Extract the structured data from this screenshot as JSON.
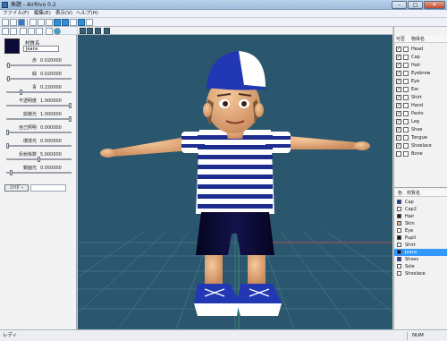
{
  "window": {
    "title": "無題 - AirRivo 0.2"
  },
  "menu": [
    "ファイル(F)",
    "編集(E)",
    "表示(V)",
    "ヘルプ(H)"
  ],
  "material_panel": {
    "label": "材質名",
    "name_value": "Jeans",
    "swatch_color": "#0c0a37",
    "params": [
      {
        "label": "赤",
        "value": "0.020000",
        "level": 0.02
      },
      {
        "label": "緑",
        "value": "0.020000",
        "level": 0.02
      },
      {
        "label": "青",
        "value": "0.220000",
        "level": 0.22
      },
      {
        "label": "不透明度",
        "value": "1.000000",
        "level": 1.0
      },
      {
        "label": "拡散光",
        "value": "1.000000",
        "level": 1.0
      },
      {
        "label": "自己照明",
        "value": "0.000000",
        "level": 0.0
      },
      {
        "label": "環境光",
        "value": "0.000000",
        "level": 0.0
      },
      {
        "label": "反射係数",
        "value": "5.000000",
        "level": 0.5
      },
      {
        "label": "鏡面光",
        "value": "0.050000",
        "level": 0.05
      }
    ],
    "apply_label": "ｽﾗｲﾀﾞｰ"
  },
  "parts_panel": {
    "col_visible": "可否",
    "col_name": "物体名",
    "items": [
      "Head",
      "Cap",
      "Hair",
      "Eyebrow",
      "Eye",
      "Ear",
      "Shirt",
      "Hand",
      "Pants",
      "Leg",
      "Shoe",
      "Tongue",
      "Shoelace",
      "Bone"
    ]
  },
  "materials_list": {
    "col_color": "色",
    "col_name": "材質名",
    "items": [
      {
        "name": "Cap",
        "color": "#1a3fa8"
      },
      {
        "name": "Cap2",
        "color": "#ffffff"
      },
      {
        "name": "Hair",
        "color": "#2a1a0a"
      },
      {
        "name": "Skin",
        "color": "#e8b080"
      },
      {
        "name": "Eye",
        "color": "#ffffff"
      },
      {
        "name": "Pupil",
        "color": "#111111"
      },
      {
        "name": "Shirt",
        "color": "#ffffff"
      },
      {
        "name": "Jeans",
        "color": "#0c0a37",
        "selected": true
      },
      {
        "name": "Shoes",
        "color": "#1a3fa8"
      },
      {
        "name": "Sole",
        "color": "#ffffff"
      },
      {
        "name": "Shoelace",
        "color": "#ffffff"
      }
    ]
  },
  "status": {
    "text": "レディ",
    "num": "NUM"
  }
}
